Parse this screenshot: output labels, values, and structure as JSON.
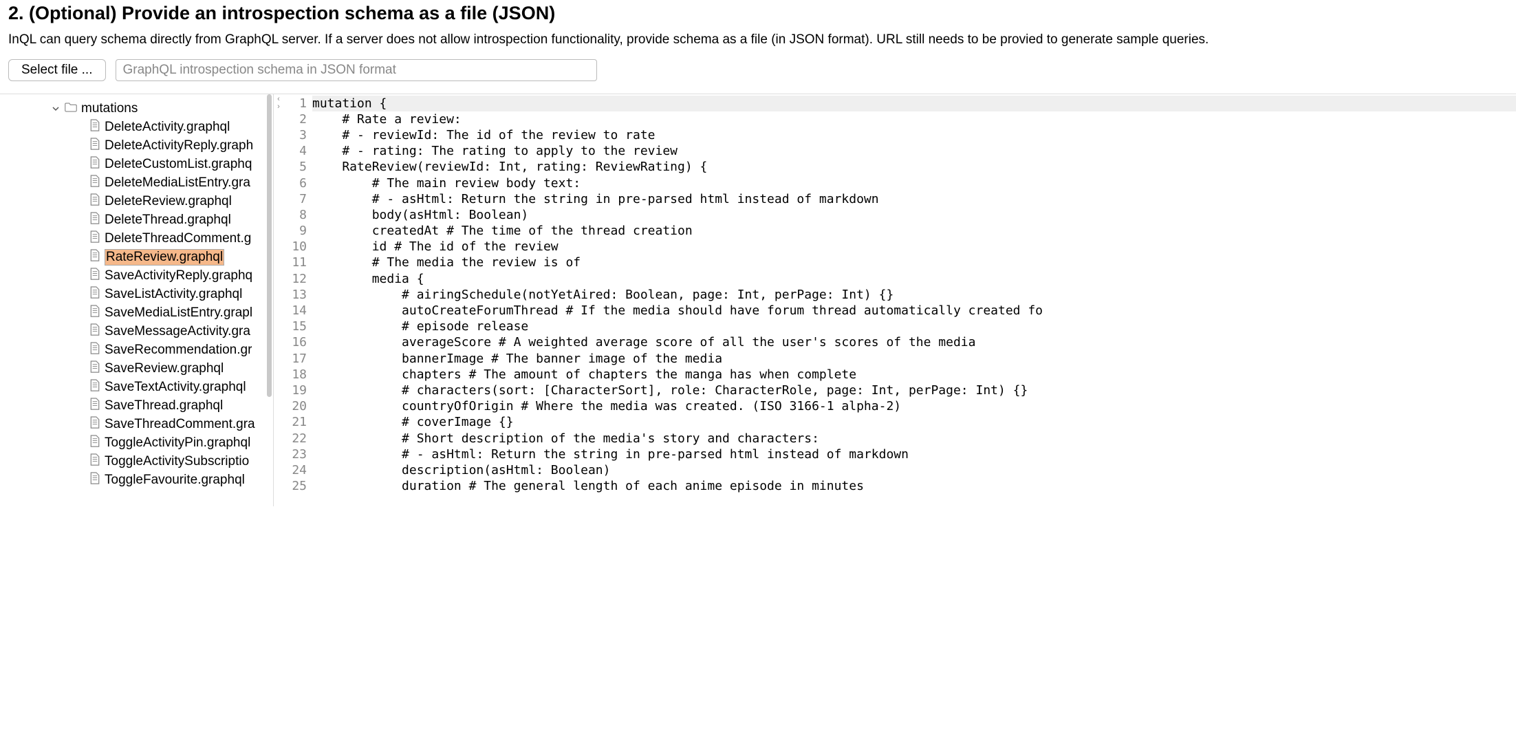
{
  "section": {
    "heading": "2. (Optional) Provide an introspection schema as a file (JSON)",
    "description": "InQL can query schema directly from GraphQL server. If a server does not allow introspection functionality, provide schema as a file (in JSON format). URL still needs to be provied to generate sample queries.",
    "select_file_label": "Select file ...",
    "file_placeholder": "GraphQL introspection schema in JSON format"
  },
  "tree": {
    "folder_label": "mutations",
    "items": [
      "DeleteActivity.graphql",
      "DeleteActivityReply.graph",
      "DeleteCustomList.graphq",
      "DeleteMediaListEntry.gra",
      "DeleteReview.graphql",
      "DeleteThread.graphql",
      "DeleteThreadComment.g",
      "RateReview.graphql",
      "SaveActivityReply.graphq",
      "SaveListActivity.graphql",
      "SaveMediaListEntry.grapl",
      "SaveMessageActivity.gra",
      "SaveRecommendation.gr",
      "SaveReview.graphql",
      "SaveTextActivity.graphql",
      "SaveThread.graphql",
      "SaveThreadComment.gra",
      "ToggleActivityPin.graphql",
      "ToggleActivitySubscriptio",
      "ToggleFavourite.graphql"
    ],
    "selected_index": 7
  },
  "code": {
    "lines": [
      "mutation {",
      "    # Rate a review:",
      "    # - reviewId: The id of the review to rate",
      "    # - rating: The rating to apply to the review",
      "    RateReview(reviewId: Int, rating: ReviewRating) {",
      "        # The main review body text:",
      "        # - asHtml: Return the string in pre-parsed html instead of markdown",
      "        body(asHtml: Boolean)",
      "        createdAt # The time of the thread creation",
      "        id # The id of the review",
      "        # The media the review is of",
      "        media {",
      "            # airingSchedule(notYetAired: Boolean, page: Int, perPage: Int) {}",
      "            autoCreateForumThread # If the media should have forum thread automatically created fo",
      "            # episode release",
      "            averageScore # A weighted average score of all the user's scores of the media",
      "            bannerImage # The banner image of the media",
      "            chapters # The amount of chapters the manga has when complete",
      "            # characters(sort: [CharacterSort], role: CharacterRole, page: Int, perPage: Int) {}",
      "            countryOfOrigin # Where the media was created. (ISO 3166-1 alpha-2)",
      "            # coverImage {}",
      "            # Short description of the media's story and characters:",
      "            # - asHtml: Return the string in pre-parsed html instead of markdown",
      "            description(asHtml: Boolean)",
      "            duration # The general length of each anime episode in minutes"
    ]
  }
}
